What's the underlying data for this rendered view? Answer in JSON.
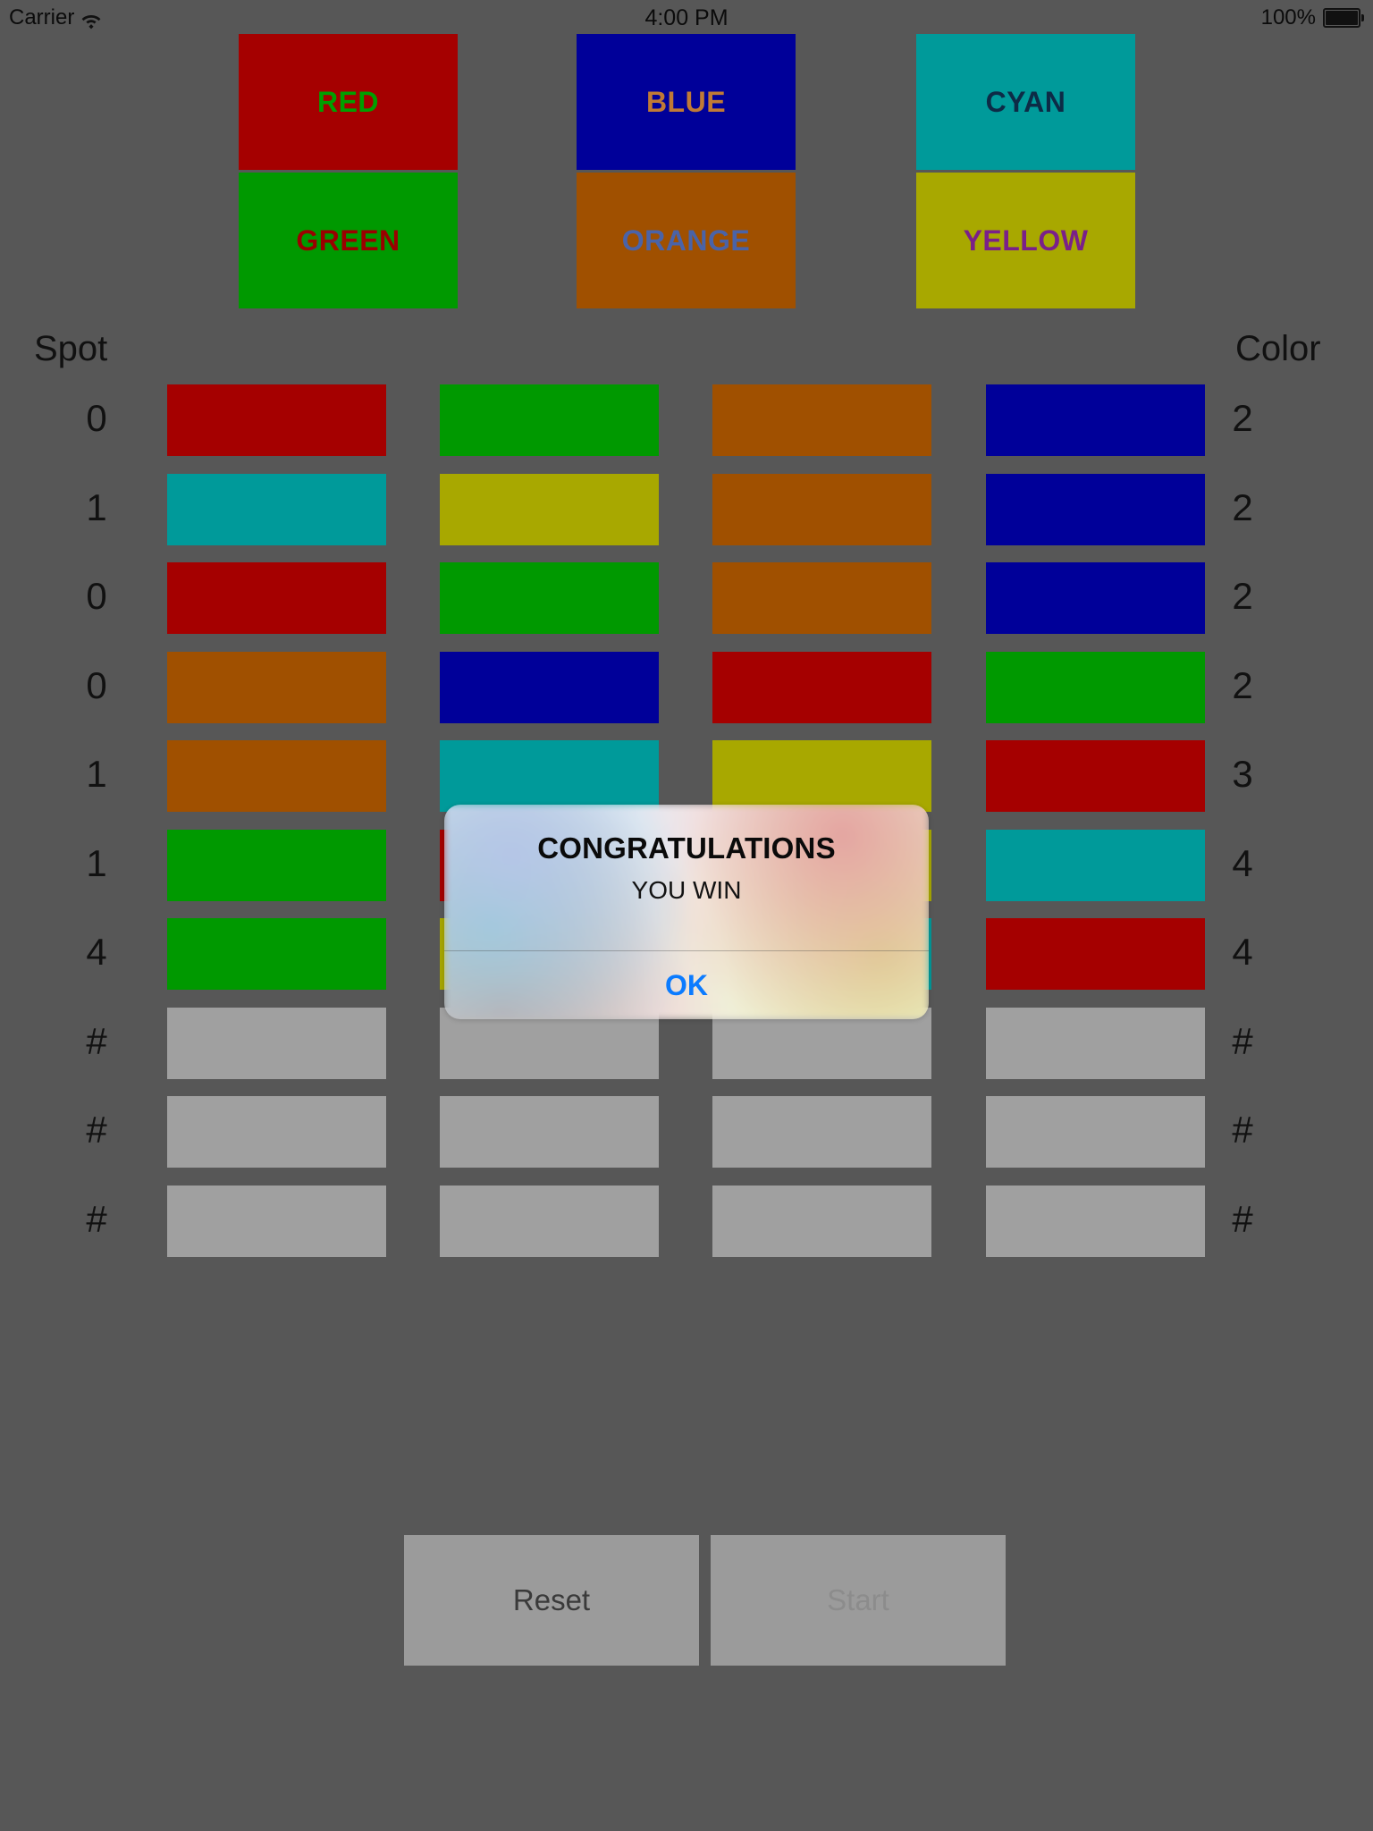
{
  "status_bar": {
    "carrier": "Carrier",
    "wifi_icon": "wifi-icon",
    "time": "4:00 PM",
    "battery_percent": "100%",
    "battery_icon": "battery-full-icon"
  },
  "palette": {
    "buttons": [
      {
        "label": "RED",
        "bg": "#a50000",
        "fg": "#00a000"
      },
      {
        "label": "BLUE",
        "bg": "#000099",
        "fg": "#c07a36"
      },
      {
        "label": "CYAN",
        "bg": "#009a9a",
        "fg": "#0d2b46"
      },
      {
        "label": "GREEN",
        "bg": "#009900",
        "fg": "#9b0000"
      },
      {
        "label": "ORANGE",
        "bg": "#a05000",
        "fg": "#4a63a8"
      },
      {
        "label": "YELLOW",
        "bg": "#a8a800",
        "fg": "#7a2089"
      }
    ]
  },
  "board": {
    "header_left": "Spot",
    "header_right": "Color",
    "empty_marker": "#",
    "empty_color": "#a0a0a0",
    "palette_hex": {
      "red": "#a50000",
      "green": "#009900",
      "blue": "#000099",
      "cyan": "#009a9a",
      "orange": "#a05000",
      "yellow": "#a8a800",
      "empty": "#a0a0a0"
    },
    "rows": [
      {
        "spot": "0",
        "color": "2",
        "cells": [
          "#a50000",
          "#009900",
          "#a05000",
          "#000099"
        ]
      },
      {
        "spot": "1",
        "color": "2",
        "cells": [
          "#009a9a",
          "#a8a800",
          "#a05000",
          "#000099"
        ]
      },
      {
        "spot": "0",
        "color": "2",
        "cells": [
          "#a50000",
          "#009900",
          "#a05000",
          "#000099"
        ]
      },
      {
        "spot": "0",
        "color": "2",
        "cells": [
          "#a05000",
          "#000099",
          "#a50000",
          "#009900"
        ]
      },
      {
        "spot": "1",
        "color": "3",
        "cells": [
          "#a05000",
          "#009a9a",
          "#a8a800",
          "#a50000"
        ]
      },
      {
        "spot": "1",
        "color": "4",
        "cells": [
          "#009900",
          "#a50000",
          "#a8a800",
          "#009a9a"
        ]
      },
      {
        "spot": "4",
        "color": "4",
        "cells": [
          "#009900",
          "#a8a800",
          "#009a9a",
          "#a50000"
        ]
      },
      {
        "spot": "#",
        "color": "#",
        "cells": [
          "#a0a0a0",
          "#a0a0a0",
          "#a0a0a0",
          "#a0a0a0"
        ]
      },
      {
        "spot": "#",
        "color": "#",
        "cells": [
          "#a0a0a0",
          "#a0a0a0",
          "#a0a0a0",
          "#a0a0a0"
        ]
      },
      {
        "spot": "#",
        "color": "#",
        "cells": [
          "#a0a0a0",
          "#a0a0a0",
          "#a0a0a0",
          "#a0a0a0"
        ]
      }
    ]
  },
  "bottom_bar": {
    "reset_label": "Reset",
    "start_label": "Start",
    "start_enabled": false
  },
  "alert": {
    "title": "CONGRATULATIONS",
    "message": "YOU WIN",
    "ok_label": "OK",
    "ok_color": "#0b7bff"
  }
}
